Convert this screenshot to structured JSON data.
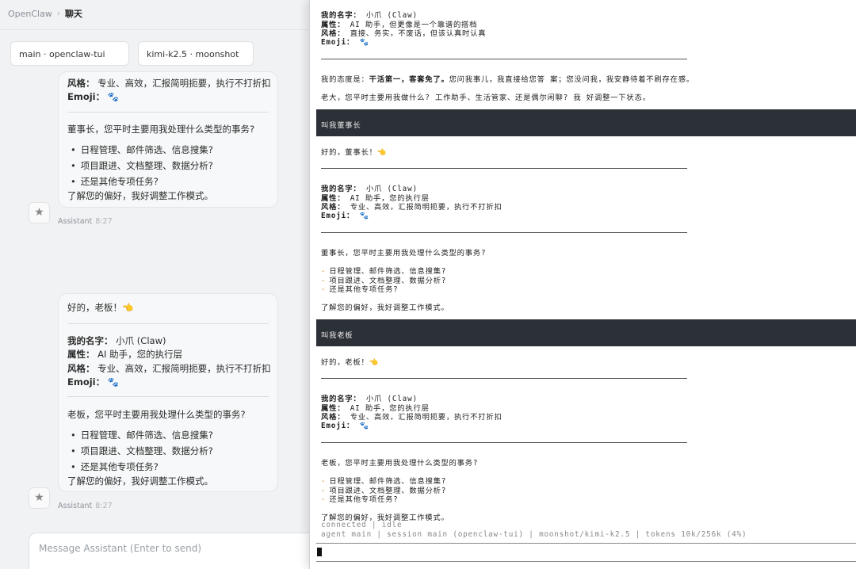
{
  "breadcrumb": {
    "root": "OpenClaw",
    "separator": "›",
    "current": "聊天"
  },
  "chips": {
    "session": "main · openclaw-tui",
    "model": "kimi-k2.5 · moonshot"
  },
  "chat": {
    "bubble1": {
      "style_label": "风格：",
      "style_value": "专业、高效，汇报简明扼要，执行不打折扣",
      "emoji_label": "Emoji：",
      "emoji_value": "🐾",
      "question": "董事长，您平时主要用我处理什么类型的事务?",
      "options": [
        "日程管理、邮件筛选、信息搜集?",
        "项目跟进、文档整理、数据分析?",
        "还是其他专项任务?"
      ],
      "closing": "了解您的偏好，我好调整工作模式。"
    },
    "meta1": {
      "sender": "Assistant",
      "time": "8:27"
    },
    "bubble2": {
      "greeting": "好的，老板！👈",
      "name_label": "我的名字：",
      "name_value": "小爪 (Claw)",
      "attr_label": "属性：",
      "attr_value": "AI 助手，您的执行层",
      "style_label": "风格：",
      "style_value": "专业、高效，汇报简明扼要，执行不打折扣",
      "emoji_label": "Emoji：",
      "emoji_value": "🐾",
      "question": "老板，您平时主要用我处理什么类型的事务?",
      "options": [
        "日程管理、邮件筛选、信息搜集?",
        "项目跟进、文档整理、数据分析?",
        "还是其他专项任务?"
      ],
      "closing": "了解您的偏好，我好调整工作模式。"
    },
    "meta2": {
      "sender": "Assistant",
      "time": "8:27"
    },
    "composer_placeholder": "Message Assistant (Enter to send)"
  },
  "terminal": {
    "intro": {
      "name_label": "我的名字：",
      "name_value": " 小爪 (Claw)",
      "attr_label": "属性：",
      "attr_value": " AI 助手，但更像是一个靠谱的搭档",
      "style_label": "风格：",
      "style_value": " 直接、务实，不废话，但该认真时认真",
      "emoji_label": "Emoji：",
      "emoji_value": " 🐾"
    },
    "attitude_prefix": "我的态度是：",
    "attitude_bold": "干活第一，客套免了。",
    "attitude_rest": "您问我事儿，我直接给您答 案；您没问我，我安静待着不刷存在感。",
    "question1": "老大，您平时主要用我做什么? 工作助手、生活管家、还是偶尔闲聊? 我 好调整一下状态。",
    "bar1": "叫我董事长",
    "reply1": {
      "greeting": "好的，董事长！👈",
      "name_label": "我的名字：",
      "name_value": " 小爪 (Claw)",
      "attr_label": "属性：",
      "attr_value": " AI 助手，您的执行层",
      "style_label": "风格：",
      "style_value": " 专业、高效，汇报简明扼要，执行不打折扣",
      "emoji_label": "Emoji：",
      "emoji_value": " 🐾",
      "question": "董事长，您平时主要用我处理什么类型的事务?",
      "options": [
        "日程管理、邮件筛选、信息搜集?",
        "项目跟进、文档整理、数据分析?",
        "还是其他专项任务?"
      ],
      "closing": "了解您的偏好，我好调整工作模式。"
    },
    "bar2": "叫我老板",
    "reply2": {
      "greeting": "好的，老板！👈",
      "name_label": "我的名字：",
      "name_value": " 小爪 (Claw)",
      "attr_label": "属性：",
      "attr_value": " AI 助手，您的执行层",
      "style_label": "风格：",
      "style_value": " 专业、高效，汇报简明扼要，执行不打折扣",
      "emoji_label": "Emoji：",
      "emoji_value": " 🐾",
      "question": "老板，您平时主要用我处理什么类型的事务?",
      "options": [
        "日程管理、邮件筛选、信息搜集?",
        "项目跟进、文档整理、数据分析?",
        "还是其他专项任务?"
      ],
      "closing": "了解您的偏好，我好调整工作模式。"
    },
    "dash": "-",
    "status": "connected | idle",
    "footer": "agent main | session main (openclaw-tui) | moonshot/kimi-k2.5 | tokens 10k/256k (4%)"
  }
}
